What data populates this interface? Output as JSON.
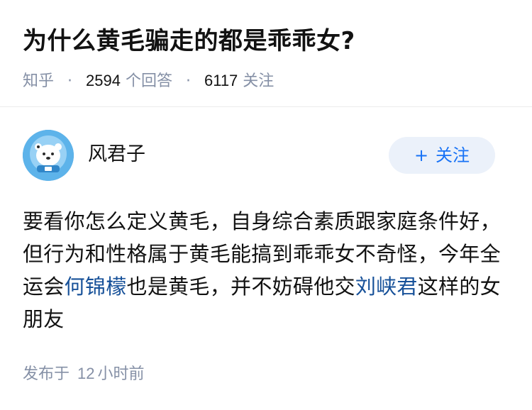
{
  "question": {
    "title": "为什么黄毛骗走的都是乖乖女?",
    "source": "知乎",
    "answer_count": "2594",
    "answer_label": "个回答",
    "follower_count": "6117",
    "follower_label": "关注"
  },
  "answer": {
    "author": {
      "name": "风君子",
      "avatar_icon": "astronaut-bear-avatar-icon"
    },
    "follow_button": {
      "label": "关注",
      "icon": "plus-icon"
    },
    "content": {
      "part1": "要看你怎么定义黄毛，自身综合素质跟家庭条件好，但行为和性格属于黄毛能搞到乖乖女不奇怪，今年全运会",
      "link1": "何锦檬",
      "part2": "也是黄毛，并不妨碍他交",
      "link2": "刘峡君",
      "part3": "这样的女朋友"
    },
    "publish": {
      "prefix": "发布于",
      "number": "12",
      "suffix": "小时前"
    }
  },
  "colors": {
    "meta_gray": "#8590a6",
    "link_blue": "#175199",
    "follow_blue": "#1772f6",
    "follow_bg": "#ebf1fa",
    "avatar_bg": "#4aa3e0"
  }
}
